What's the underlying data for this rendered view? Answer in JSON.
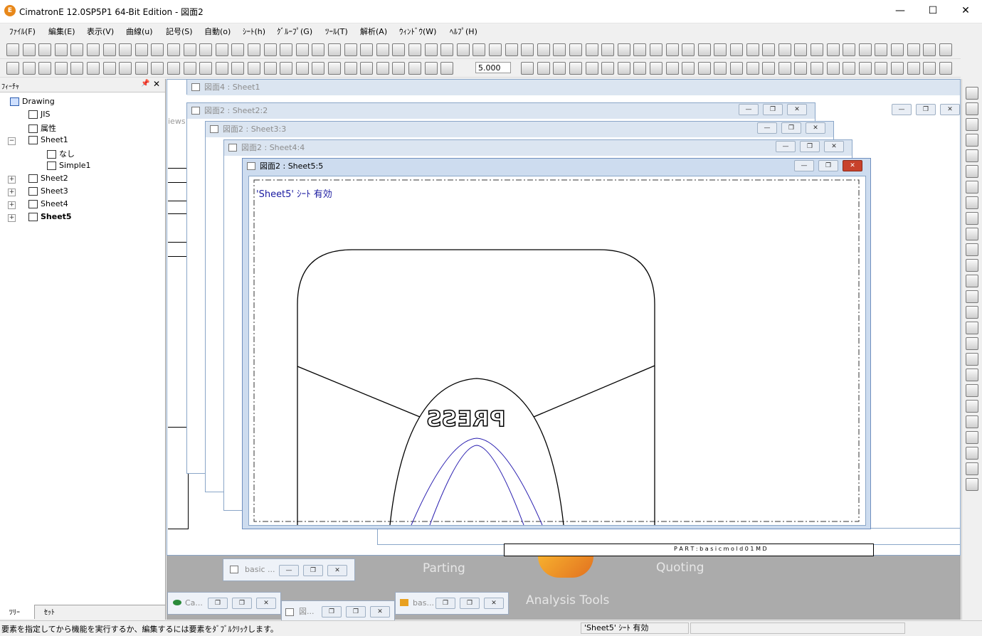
{
  "window": {
    "title": "CimatronE 12.0SP5P1  64-Bit Edition - 図面2",
    "icon_glyph": "E"
  },
  "winctl": {
    "minimize": "—",
    "maximize": "☐",
    "close": "✕"
  },
  "menu": [
    "ﾌｧｲﾙ(F)",
    "編集(E)",
    "表示(V)",
    "曲線(u)",
    "記号(S)",
    "自動(o)",
    "ｼｰﾄ(h)",
    "ｸﾞﾙｰﾌﾟ(G)",
    "ﾂｰﾙ(T)",
    "解析(A)",
    "ｳｨﾝﾄﾞｳ(W)",
    "ﾍﾙﾌﾟ(H)"
  ],
  "toolbar": {
    "scale_value": "5.000"
  },
  "feature_panel": {
    "title": "ﾌｨｰﾁｬ",
    "pin": "📌",
    "close": "✕",
    "tree": [
      {
        "label": "Drawing"
      },
      {
        "label": "JIS"
      },
      {
        "label": "属性"
      },
      {
        "label": "Sheet1"
      },
      {
        "label": "なし"
      },
      {
        "label": "Simple1"
      },
      {
        "label": "Sheet2"
      },
      {
        "label": "Sheet3"
      },
      {
        "label": "Sheet4"
      },
      {
        "label": "Sheet5"
      }
    ],
    "tabs": [
      "ﾂﾘｰ",
      "ｾｯﾄ"
    ]
  },
  "mdi": {
    "sheet_windows": [
      {
        "title": "図面4 : Sheet1"
      },
      {
        "title": "図面2 : Sheet2:2"
      },
      {
        "title": "図面2 : Sheet3:3"
      },
      {
        "title": "図面2 : Sheet4:4"
      },
      {
        "title": "図面2 : Sheet5:5"
      }
    ],
    "sheet_active_note": "'Sheet5' ｼｰﾄ 有効",
    "views_fragment": "iews",
    "part_label": "P A R T : b a s i c m o l d 0 1   M D",
    "drawing_text": "PRESS",
    "buttons": {
      "minimize": "—",
      "restore": "❐",
      "close": "✕"
    },
    "minimized": [
      {
        "title": "basic ..."
      },
      {
        "title": "Ca..."
      },
      {
        "title": "図..."
      },
      {
        "title": "bas..."
      }
    ],
    "banner": {
      "parting": "Parting",
      "quoting": "Quoting",
      "analysis": "Analysis Tools"
    }
  },
  "status": {
    "hint": "要素を指定してから機能を実行するか、編集するには要素をﾀﾞﾌﾞﾙｸﾘｯｸします。",
    "sheet": "'Sheet5' ｼｰﾄ 有効"
  }
}
